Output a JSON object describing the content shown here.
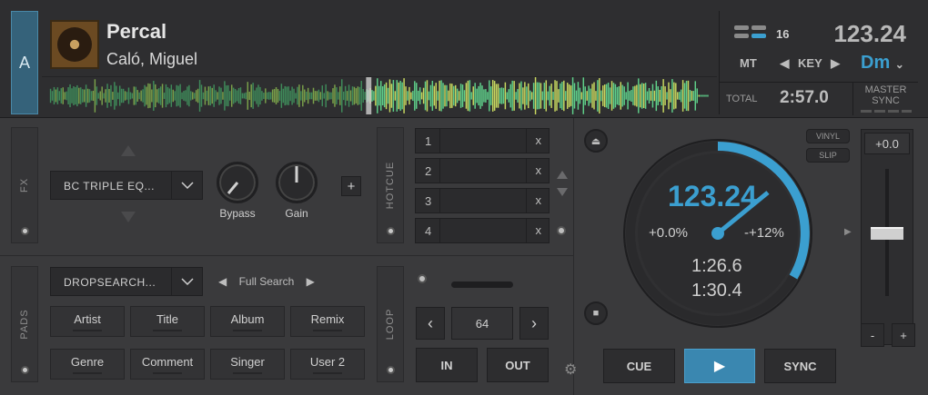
{
  "deck": {
    "letter": "A",
    "title": "Percal",
    "artist": "Caló, Miguel",
    "bpm": "123.24",
    "loop_beats": "16",
    "key_mode": "MT",
    "key_label": "KEY",
    "key_value": "Dm",
    "total_label": "TOTAL",
    "total_time": "2:57.0",
    "master_label": "MASTER",
    "sync_label": "SYNC"
  },
  "fx": {
    "tab": "FX",
    "effect": "BC TRIPLE EQ...",
    "knobs": [
      "Bypass",
      "Gain"
    ],
    "add": "+"
  },
  "hotcue": {
    "tab": "HOTCUE",
    "slots": [
      {
        "n": "1",
        "x": "x"
      },
      {
        "n": "2",
        "x": "x"
      },
      {
        "n": "3",
        "x": "x"
      },
      {
        "n": "4",
        "x": "x"
      }
    ]
  },
  "pads": {
    "tab": "PADS",
    "mode": "DROPSEARCH...",
    "search_mode": "Full Search",
    "buttons": [
      "Artist",
      "Title",
      "Album",
      "Remix",
      "Genre",
      "Comment",
      "Singer",
      "User 2"
    ]
  },
  "loop": {
    "tab": "LOOP",
    "size": "64",
    "in_label": "IN",
    "out_label": "OUT"
  },
  "jog": {
    "bpm": "123.24",
    "pitch": "+0.0%",
    "range": "-+12%",
    "elapsed": "1:26.6",
    "remaining": "1:30.4",
    "vinyl": "VINYL",
    "slip": "SLIP"
  },
  "pitch": {
    "value": "+0.0",
    "minus": "-",
    "plus": "+"
  },
  "transport": {
    "cue": "CUE",
    "play": "▶",
    "sync": "SYNC"
  },
  "colors": {
    "accent": "#3b9fd0",
    "play_bg": "#3a87b0"
  }
}
